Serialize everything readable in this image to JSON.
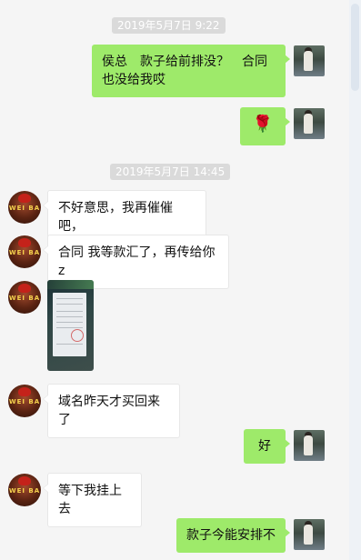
{
  "timestamps": [
    "2019年5月7日 9:22",
    "2019年5月7日 14:45"
  ],
  "messages": [
    {
      "sender": "me",
      "type": "text",
      "text": "侯总　款子给前排没？　合同也没给我哎"
    },
    {
      "sender": "me",
      "type": "emoji",
      "text": "🌹"
    },
    {
      "sender": "them",
      "type": "text",
      "text": "不好意思，我再催催吧，"
    },
    {
      "sender": "them",
      "type": "text",
      "text": "合同 我等款汇了，再传给你z"
    },
    {
      "sender": "them",
      "type": "image",
      "text": ""
    },
    {
      "sender": "them",
      "type": "text",
      "text": "域名昨天才买回来了"
    },
    {
      "sender": "me",
      "type": "text",
      "text": "好"
    },
    {
      "sender": "them",
      "type": "text",
      "text": "等下我挂上去"
    },
    {
      "sender": "me",
      "type": "text",
      "text": "款子今能安排不"
    }
  ],
  "contact_avatar_text": "WEI BA",
  "colors": {
    "my_bubble": "#9eea6a",
    "their_bubble": "#ffffff",
    "background": "#f5f5f5",
    "timestamp_bg": "#dadada"
  }
}
